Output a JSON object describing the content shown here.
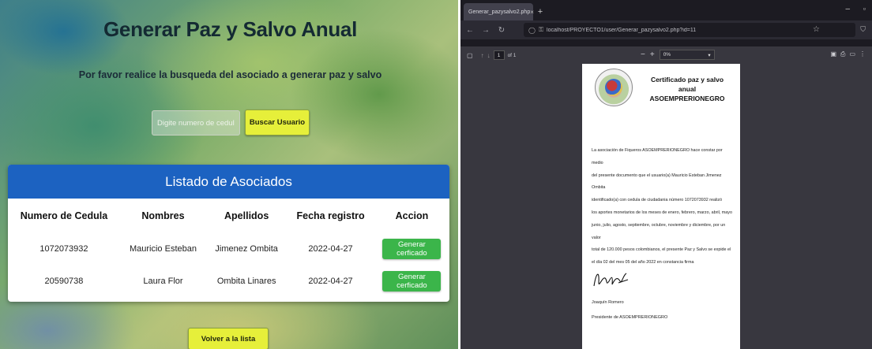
{
  "app": {
    "title": "Generar Paz y Salvo Anual",
    "subtitle": "Por favor realice la busqueda del asociado a generar paz y salvo",
    "search_placeholder": "Digite numero de cedula",
    "search_button": "Buscar Usuario",
    "list_title": "Listado de Asociados",
    "columns": [
      "Numero de Cedula",
      "Nombres",
      "Apellidos",
      "Fecha registro",
      "Accion"
    ],
    "rows": [
      {
        "cedula": "1072073932",
        "nombres": "Mauricio Esteban",
        "apellidos": "Jimenez Ombita",
        "fecha": "2022-04-27",
        "accion": "Generar cerficado"
      },
      {
        "cedula": "20590738",
        "nombres": "Laura Flor",
        "apellidos": "Ombita Linares",
        "fecha": "2022-04-27",
        "accion": "Generar cerficado"
      }
    ],
    "back_button": "Volver a la lista"
  },
  "browser": {
    "tab_title": "Generar_pazysalvo2.php",
    "url": "localhost/PROYECTO1/user/Generar_pazysalvo2.php?id=11",
    "page_current": "1",
    "page_total": "of 1",
    "zoom_value": "0%",
    "zoom_minus": "−",
    "zoom_plus": "+"
  },
  "document": {
    "title_line1": "Certificado paz y salvo anual",
    "title_line2": "ASOEMPRERIONEGRO",
    "body_lines": [
      "La asociación de Fiqueros ASOEMPRERIONEGRO hace constar por medio",
      "del presente documento que el usuario(a) Mauricio Esteban Jimenez Ombita",
      "identificado(a) con cedula de ciudadania número 1072073932 realizó",
      "los aportes monetarios de los meses de enero, febrero, marzo, abril, mayo",
      "junio, julio, agosto, septiembre, octubre, noviembre y diciembre, por un valor",
      "total de 120.000 pesos colombianos, el presente Paz y Salvo se expide el",
      "el día 02 del mes 05 del año 2022 en constancia firma"
    ],
    "signer_name": "Joaquín Romero",
    "signer_role": "Presidente de ASOEMPRERIONEGRO"
  }
}
